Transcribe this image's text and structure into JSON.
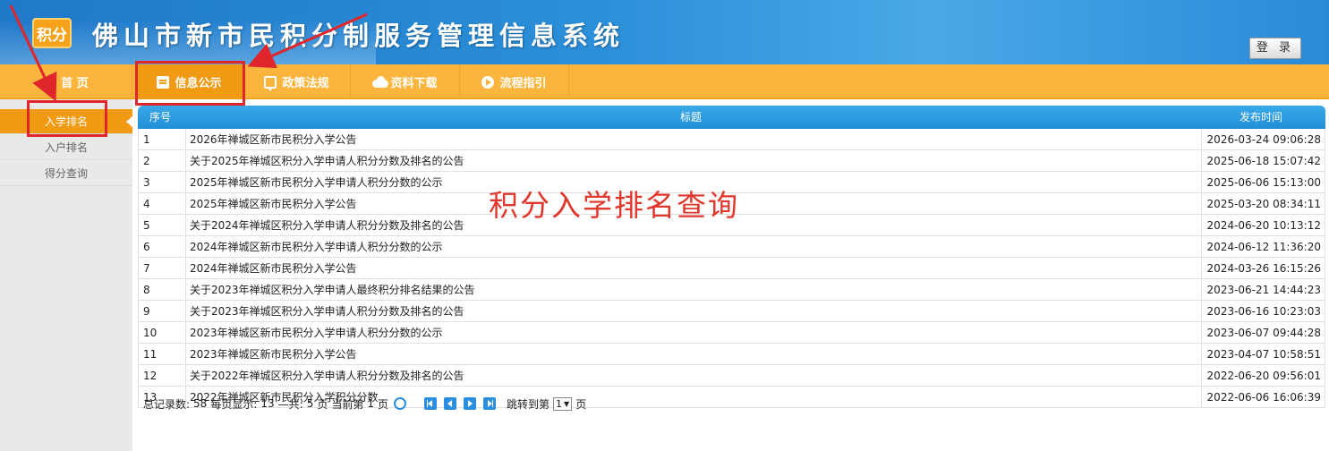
{
  "header": {
    "logo_text": "积分",
    "title": "佛山市新市民积分制服务管理信息系统",
    "login_label": "登 录"
  },
  "nav": {
    "items": [
      {
        "label": "首 页",
        "icon": "home-icon"
      },
      {
        "label": "信息公示",
        "icon": "document-icon"
      },
      {
        "label": "政策法规",
        "icon": "chat-icon"
      },
      {
        "label": "资料下载",
        "icon": "cloud-download-icon"
      },
      {
        "label": "流程指引",
        "icon": "play-circle-icon"
      }
    ],
    "active_index": 1
  },
  "sidebar": {
    "items": [
      {
        "label": "入学排名"
      },
      {
        "label": "入户排名"
      },
      {
        "label": "得分查询"
      }
    ],
    "active_index": 0
  },
  "table": {
    "headers": {
      "no": "序号",
      "title": "标题",
      "date": "发布时间"
    },
    "rows": [
      {
        "no": "1",
        "title": "2026年禅城区新市民积分入学公告",
        "date": "2026-03-24 09:06:28"
      },
      {
        "no": "2",
        "title": "关于2025年禅城区积分入学申请人积分分数及排名的公告",
        "date": "2025-06-18 15:07:42"
      },
      {
        "no": "3",
        "title": "2025年禅城区新市民积分入学申请人积分分数的公示",
        "date": "2025-06-06 15:13:00"
      },
      {
        "no": "4",
        "title": "2025年禅城区新市民积分入学公告",
        "date": "2025-03-20 08:34:11"
      },
      {
        "no": "5",
        "title": "关于2024年禅城区积分入学申请人积分分数及排名的公告",
        "date": "2024-06-20 10:13:12"
      },
      {
        "no": "6",
        "title": "2024年禅城区新市民积分入学申请人积分分数的公示",
        "date": "2024-06-12 11:36:20"
      },
      {
        "no": "7",
        "title": "2024年禅城区新市民积分入学公告",
        "date": "2024-03-26 16:15:26"
      },
      {
        "no": "8",
        "title": "关于2023年禅城区积分入学申请人最终积分排名结果的公告",
        "date": "2023-06-21 14:44:23"
      },
      {
        "no": "9",
        "title": "关于2023年禅城区积分入学申请人积分分数及排名的公告",
        "date": "2023-06-16 10:23:03"
      },
      {
        "no": "10",
        "title": "2023年禅城区新市民积分入学申请人积分分数的公示",
        "date": "2023-06-07 09:44:28"
      },
      {
        "no": "11",
        "title": "2023年禅城区新市民积分入学公告",
        "date": "2023-04-07 10:58:51"
      },
      {
        "no": "12",
        "title": "关于2022年禅城区积分入学申请人积分分数及排名的公告",
        "date": "2022-06-20 09:56:01"
      },
      {
        "no": "13",
        "title": "2022年禅城区新市民积分入学积分分数",
        "date": "2022-06-06 16:06:39"
      }
    ]
  },
  "pager": {
    "total_label": "总记录数:",
    "total": "58",
    "per_page_label": "每页显示:",
    "per_page": "13",
    "pages_prefix": "—共:",
    "pages": "5",
    "pages_suffix": "页",
    "current_prefix": "当前第",
    "current": "1",
    "current_suffix": "页",
    "jump_prefix": "跳转到第",
    "jump_value": "1",
    "jump_suffix": "页"
  },
  "annotation": {
    "text": "积分入学排名查询",
    "color": "#e0262b"
  }
}
